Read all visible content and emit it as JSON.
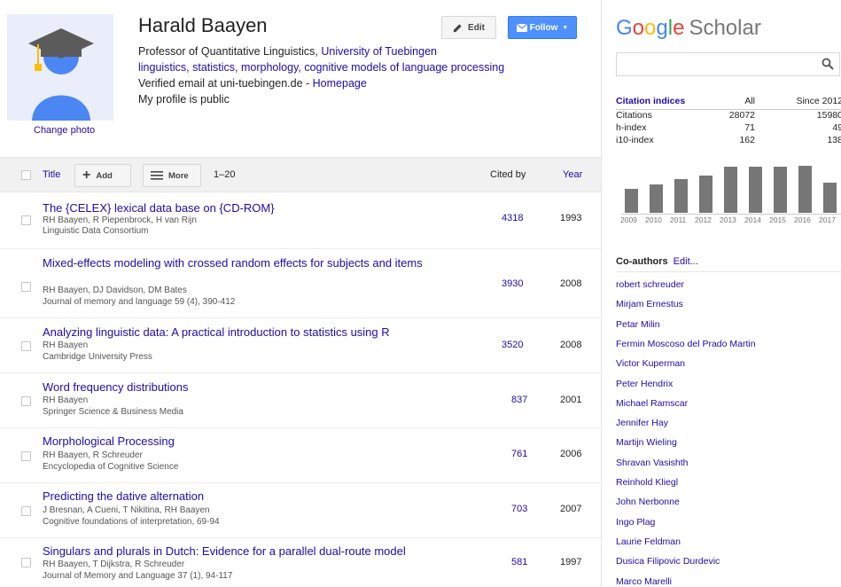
{
  "profile": {
    "name": "Harald Baayen",
    "title_prefix": "Professor of Quantitative Linguistics, ",
    "affiliation": "University of Tuebingen",
    "interests": "linguistics, statistics, morphology, cognitive models of language processing",
    "verified_email": "Verified email at uni-tuebingen.de - ",
    "homepage": "Homepage",
    "public_status": "My profile is public",
    "change_photo": "Change photo"
  },
  "buttons": {
    "edit": "Edit",
    "follow": "Follow"
  },
  "table": {
    "title_header": "Title",
    "add": "Add",
    "more": "More",
    "range": "1–20",
    "cited_header": "Cited by",
    "year_header": "Year",
    "rows": [
      {
        "title": "The {CELEX} lexical data base on {CD-ROM}",
        "authors": "RH Baayen, R Piepenbrock, H van Rijn",
        "venue": "Linguistic Data Consortium",
        "cited": "4318",
        "year": "1993"
      },
      {
        "title": "Mixed-effects modeling with crossed random effects for subjects and items",
        "authors": "RH Baayen, DJ Davidson, DM Bates",
        "venue": "Journal of memory and language 59 (4), 390-412",
        "cited": "3930",
        "year": "2008"
      },
      {
        "title": "Analyzing linguistic data: A practical introduction to statistics using R",
        "authors": "RH Baayen",
        "venue": "Cambridge University Press",
        "cited": "3520",
        "year": "2008"
      },
      {
        "title": "Word frequency distributions",
        "authors": "RH Baayen",
        "venue": "Springer Science & Business Media",
        "cited": "837",
        "year": "2001"
      },
      {
        "title": "Morphological Processing",
        "authors": "RH Baayen, R Schreuder",
        "venue": "Encyclopedia of Cognitive Science",
        "cited": "761",
        "year": "2006"
      },
      {
        "title": "Predicting the dative alternation",
        "authors": "J Bresnan, A Cueni, T Nikitina, RH Baayen",
        "venue": "Cognitive foundations of interpretation, 69-94",
        "cited": "703",
        "year": "2007"
      },
      {
        "title": "Singulars and plurals in Dutch: Evidence for a parallel dual-route model",
        "authors": "RH Baayen, T Dijkstra, R Schreuder",
        "venue": "Journal of Memory and Language 37 (1), 94-117",
        "cited": "581",
        "year": "1997"
      }
    ]
  },
  "sidebar": {
    "logo_google": "Google",
    "logo_scholar": "Scholar",
    "search_placeholder": "",
    "citation_header": "Citation indices",
    "col_all": "All",
    "col_since": "Since 2012",
    "indices": [
      {
        "label": "Citations",
        "all": "28072",
        "since": "15980"
      },
      {
        "label": "h-index",
        "all": "71",
        "since": "49"
      },
      {
        "label": "i10-index",
        "all": "162",
        "since": "138"
      }
    ],
    "coauthors_title": "Co-authors",
    "coauthors_edit": "Edit...",
    "coauthors": [
      "robert schreuder",
      "Mirjam Ernestus",
      "Petar Milin",
      "Fermin Moscoso del Prado Martin",
      "Victor Kuperman",
      "Peter Hendrix",
      "Michael Ramscar",
      "Jennifer Hay",
      "Martijn Wieling",
      "Shravan Vasishth",
      "Reinhold Kliegl",
      "John Nerbonne",
      "Ingo Plag",
      "Laurie Feldman",
      "Dusica Filipovic Durdevic",
      "Marco Marelli"
    ]
  },
  "chart_data": {
    "type": "bar",
    "categories": [
      "2009",
      "2010",
      "2011",
      "2012",
      "2013",
      "2014",
      "2015",
      "2016",
      "2017"
    ],
    "values": [
      1450,
      1700,
      2050,
      2250,
      2800,
      2800,
      2800,
      2850,
      1800
    ],
    "ylim": [
      0,
      3000
    ],
    "grid": false
  },
  "colors": {
    "link": "#1a0dab",
    "follow_blue": "#4d90fe",
    "bar": "#777777"
  }
}
